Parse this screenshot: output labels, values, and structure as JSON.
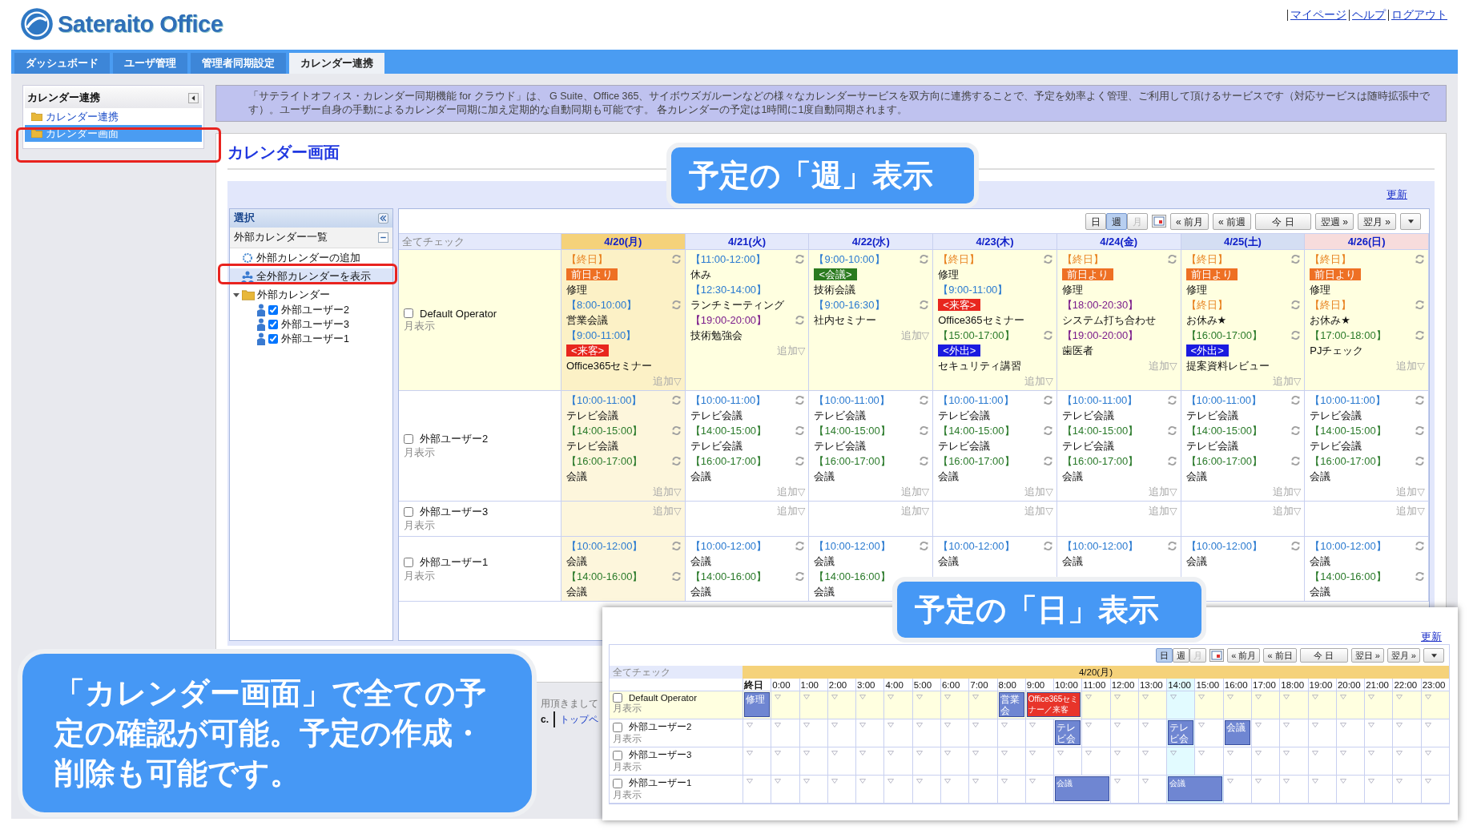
{
  "logo": {
    "text": "Sateraito Office"
  },
  "top_links": [
    "マイページ",
    "ヘルプ",
    "ログアウト"
  ],
  "nav_tabs": [
    {
      "label": "ダッシュボード",
      "selected": false
    },
    {
      "label": "ユーザ管理",
      "selected": false
    },
    {
      "label": "管理者同期設定",
      "selected": false
    },
    {
      "label": "カレンダー連携",
      "selected": true
    }
  ],
  "sidebar": {
    "title": "カレンダー連携",
    "items": [
      {
        "label": "カレンダー連携",
        "selected": false
      },
      {
        "label": "カレンダー画面",
        "selected": true
      }
    ]
  },
  "banner": "「サテライトオフィス・カレンダー同期機能 for クラウド」は、 G Suite、Office 365、サイボウズガルーンなどの様々なカレンダーサービスを双方向に連携することで、予定を効率よく管理、ご利用して頂けるサービスです（対応サービスは随時拡張中です）。ユーザー自身の手動によるカレンダー同期に加え定期的な自動同期も可能です。 各カレンダーの予定は1時間に1度自動同期されます。",
  "page_title": "カレンダー画面",
  "week_view": {
    "refresh": "更新",
    "select_panel": {
      "title": "選択",
      "list_title": "外部カレンダー一覧",
      "tree": [
        {
          "kind": "add",
          "label": "外部カレンダーの追加",
          "selected": false
        },
        {
          "kind": "show_all",
          "label": "全外部カレンダーを表示",
          "selected": true
        },
        {
          "kind": "folder",
          "label": "外部カレンダー",
          "expanded": true,
          "selected": false,
          "children": [
            {
              "label": "外部ユーザー2",
              "checked": true
            },
            {
              "label": "外部ユーザー3",
              "checked": true
            },
            {
              "label": "外部ユーザー1",
              "checked": true
            }
          ]
        }
      ]
    },
    "toolbar": {
      "views": [
        {
          "label": "日",
          "selected": false,
          "disabled": false
        },
        {
          "label": "週",
          "selected": true,
          "disabled": false
        },
        {
          "label": "月",
          "selected": false,
          "disabled": true
        }
      ],
      "buttons": [
        "« 前月",
        "« 前週",
        "今 日",
        "翌週 »",
        "翌月 »"
      ]
    },
    "check_all": "全てチェック",
    "days": [
      {
        "label": "4/20(月)",
        "kind": "today"
      },
      {
        "label": "4/21(火)",
        "kind": "normal"
      },
      {
        "label": "4/22(水)",
        "kind": "normal"
      },
      {
        "label": "4/23(木)",
        "kind": "normal"
      },
      {
        "label": "4/24(金)",
        "kind": "normal"
      },
      {
        "label": "4/25(土)",
        "kind": "saturday"
      },
      {
        "label": "4/26(日)",
        "kind": "sunday"
      }
    ],
    "rows": [
      {
        "name": "Default Operator",
        "sub": "月表示",
        "checked": false,
        "own": true,
        "cells": [
          {
            "add": "追加▽",
            "events": [
              {
                "time": "【終日】",
                "color": "#e8801e",
                "tag": {
                  "label": "前日より",
                  "color": "#ee7024"
                },
                "title": "修理",
                "sync": true
              },
              {
                "time": "【8:00-10:00】",
                "color": "#2a7ad0",
                "title": "営業会議",
                "sync": true
              },
              {
                "time": "【9:00-11:00】",
                "color": "#2a7ad0",
                "tag": {
                  "label": "<来客>",
                  "color": "#e8261e"
                },
                "title": "Office365セミナー",
                "sync": false
              }
            ]
          },
          {
            "add": "追加▽",
            "events": [
              {
                "time": "【11:00-12:00】",
                "color": "#2a7ad0",
                "title": "休み",
                "sync": true
              },
              {
                "time": "【12:30-14:00】",
                "color": "#2a7ad0",
                "title": "ランチミーティング",
                "sync": false
              },
              {
                "time": "【19:00-20:00】",
                "color": "#7a1a8a",
                "title": "技術勉強会",
                "sync": true
              }
            ]
          },
          {
            "add": "追加▽",
            "events": [
              {
                "time": "【9:00-10:00】",
                "color": "#2a7ad0",
                "tag": {
                  "label": "<会議>",
                  "color": "#2a7a1e"
                },
                "title": "技術会議",
                "sync": true
              },
              {
                "time": "【9:00-16:30】",
                "color": "#2a7ad0",
                "title": "社内セミナー",
                "sync": true
              }
            ]
          },
          {
            "add": "追加▽",
            "events": [
              {
                "time": "【終日】",
                "color": "#e8801e",
                "title": "修理",
                "sync": true
              },
              {
                "time": "【9:00-11:00】",
                "color": "#2a7ad0",
                "tag": {
                  "label": "<来客>",
                  "color": "#e8261e"
                },
                "title": "Office365セミナー",
                "sync": false
              },
              {
                "time": "【15:00-17:00】",
                "color": "#2a7a2a",
                "tag": {
                  "label": "<外出>",
                  "color": "#1a1ae0"
                },
                "title": "セキュリティ講習",
                "sync": true
              }
            ]
          },
          {
            "add": "追加▽",
            "events": [
              {
                "time": "【終日】",
                "color": "#e8801e",
                "tag": {
                  "label": "前日より",
                  "color": "#ee7024"
                },
                "title": "修理",
                "sync": true
              },
              {
                "time": "【18:00-20:30】",
                "color": "#7a1a8a",
                "title": "システム打ち合わせ",
                "sync": false
              },
              {
                "time": "【19:00-20:00】",
                "color": "#7a1a8a",
                "title": "歯医者",
                "sync": false
              }
            ]
          },
          {
            "add": "追加▽",
            "events": [
              {
                "time": "【終日】",
                "color": "#e8801e",
                "tag": {
                  "label": "前日より",
                  "color": "#ee7024"
                },
                "title": "修理",
                "sync": true
              },
              {
                "time": "【終日】",
                "color": "#e8801e",
                "title": "お休み★",
                "sync": true
              },
              {
                "time": "【16:00-17:00】",
                "color": "#2a7a2a",
                "tag": {
                  "label": "<外出>",
                  "color": "#1a1ae0"
                },
                "title": "提案資料レビュー",
                "sync": true
              }
            ]
          },
          {
            "add": "追加▽",
            "events": [
              {
                "time": "【終日】",
                "color": "#e8801e",
                "tag": {
                  "label": "前日より",
                  "color": "#ee7024"
                },
                "title": "修理",
                "sync": true
              },
              {
                "time": "【終日】",
                "color": "#e8801e",
                "title": "お休み★",
                "sync": true
              },
              {
                "time": "【17:00-18:00】",
                "color": "#2a7a2a",
                "title": "PJチェック",
                "sync": true
              }
            ]
          }
        ]
      },
      {
        "name": "外部ユーザー2",
        "sub": "月表示",
        "checked": false,
        "own": false,
        "cells": [
          {
            "add": "追加▽",
            "events": [
              {
                "time": "【10:00-11:00】",
                "color": "#2a7ad0",
                "title": "テレビ会議",
                "sync": true
              },
              {
                "time": "【14:00-15:00】",
                "color": "#2a7a2a",
                "title": "テレビ会議",
                "sync": true
              },
              {
                "time": "【16:00-17:00】",
                "color": "#2a7a2a",
                "title": "会議",
                "sync": true
              }
            ]
          },
          {
            "add": "追加▽",
            "events": [
              {
                "time": "【10:00-11:00】",
                "color": "#2a7ad0",
                "title": "テレビ会議",
                "sync": true
              },
              {
                "time": "【14:00-15:00】",
                "color": "#2a7a2a",
                "title": "テレビ会議",
                "sync": true
              },
              {
                "time": "【16:00-17:00】",
                "color": "#2a7a2a",
                "title": "会議",
                "sync": true
              }
            ]
          },
          {
            "add": "追加▽",
            "events": [
              {
                "time": "【10:00-11:00】",
                "color": "#2a7ad0",
                "title": "テレビ会議",
                "sync": true
              },
              {
                "time": "【14:00-15:00】",
                "color": "#2a7a2a",
                "title": "テレビ会議",
                "sync": true
              },
              {
                "time": "【16:00-17:00】",
                "color": "#2a7a2a",
                "title": "会議",
                "sync": true
              }
            ]
          },
          {
            "add": "追加▽",
            "events": [
              {
                "time": "【10:00-11:00】",
                "color": "#2a7ad0",
                "title": "テレビ会議",
                "sync": true
              },
              {
                "time": "【14:00-15:00】",
                "color": "#2a7a2a",
                "title": "テレビ会議",
                "sync": true
              },
              {
                "time": "【16:00-17:00】",
                "color": "#2a7a2a",
                "title": "会議",
                "sync": true
              }
            ]
          },
          {
            "add": "追加▽",
            "events": [
              {
                "time": "【10:00-11:00】",
                "color": "#2a7ad0",
                "title": "テレビ会議",
                "sync": true
              },
              {
                "time": "【14:00-15:00】",
                "color": "#2a7a2a",
                "title": "テレビ会議",
                "sync": true
              },
              {
                "time": "【16:00-17:00】",
                "color": "#2a7a2a",
                "title": "会議",
                "sync": true
              }
            ]
          },
          {
            "add": "追加▽",
            "events": [
              {
                "time": "【10:00-11:00】",
                "color": "#2a7ad0",
                "title": "テレビ会議",
                "sync": true
              },
              {
                "time": "【14:00-15:00】",
                "color": "#2a7a2a",
                "title": "テレビ会議",
                "sync": true
              },
              {
                "time": "【16:00-17:00】",
                "color": "#2a7a2a",
                "title": "会議",
                "sync": true
              }
            ]
          },
          {
            "add": "追加▽",
            "events": [
              {
                "time": "【10:00-11:00】",
                "color": "#2a7ad0",
                "title": "テレビ会議",
                "sync": true
              },
              {
                "time": "【14:00-15:00】",
                "color": "#2a7a2a",
                "title": "テレビ会議",
                "sync": true
              },
              {
                "time": "【16:00-17:00】",
                "color": "#2a7a2a",
                "title": "会議",
                "sync": true
              }
            ]
          }
        ]
      },
      {
        "name": "外部ユーザー3",
        "sub": "月表示",
        "checked": false,
        "own": false,
        "cells": [
          {
            "add": "追加▽"
          },
          {
            "add": "追加▽"
          },
          {
            "add": "追加▽"
          },
          {
            "add": "追加▽"
          },
          {
            "add": "追加▽"
          },
          {
            "add": "追加▽"
          },
          {
            "add": "追加▽"
          }
        ]
      },
      {
        "name": "外部ユーザー1",
        "sub": "月表示",
        "checked": false,
        "own": false,
        "cells": [
          {
            "events": [
              {
                "time": "【10:00-12:00】",
                "color": "#2a7ad0",
                "title": "会議",
                "sync": true
              },
              {
                "time": "【14:00-16:00】",
                "color": "#2a7a2a",
                "title": "会議",
                "sync": true
              }
            ]
          },
          {
            "events": [
              {
                "time": "【10:00-12:00】",
                "color": "#2a7ad0",
                "title": "会議",
                "sync": true
              },
              {
                "time": "【14:00-16:00】",
                "color": "#2a7a2a",
                "title": "会議",
                "sync": true
              }
            ]
          },
          {
            "events": [
              {
                "time": "【10:00-12:00】",
                "color": "#2a7ad0",
                "title": "会議",
                "sync": true
              },
              {
                "time": "【14:00-16:00】",
                "color": "#2a7a2a",
                "title": "会議",
                "sync": false
              }
            ]
          },
          {
            "events": [
              {
                "time": "【10:00-12:00】",
                "color": "#2a7ad0",
                "title": "会議",
                "sync": true
              }
            ]
          },
          {
            "events": [
              {
                "time": "【10:00-12:00】",
                "color": "#2a7ad0",
                "title": "会議",
                "sync": true
              }
            ]
          },
          {
            "events": [
              {
                "time": "【10:00-12:00】",
                "color": "#2a7ad0",
                "title": "会議",
                "sync": true
              }
            ]
          },
          {
            "events": [
              {
                "time": "【10:00-12:00】",
                "color": "#2a7ad0",
                "title": "会議",
                "sync": true
              },
              {
                "time": "【14:00-16:00】",
                "color": "#2a7a2a",
                "title": "会議",
                "sync": true
              }
            ]
          }
        ]
      }
    ]
  },
  "footer": {
    "line": "用頂きまして",
    "company": "c.",
    "link": "トップペ"
  },
  "day_view": {
    "refresh": "更新",
    "toolbar": {
      "views": [
        {
          "label": "日",
          "selected": true,
          "disabled": false
        },
        {
          "label": "週",
          "selected": false,
          "disabled": false
        },
        {
          "label": "月",
          "selected": false,
          "disabled": true
        }
      ],
      "buttons": [
        "« 前月",
        "« 前日",
        "今 日",
        "翌日 »",
        "翌月 »"
      ]
    },
    "check_all": "全てチェック",
    "date": "4/20(月)",
    "hours": [
      {
        "label": "終日",
        "current": false
      },
      {
        "label": "0:00",
        "current": false
      },
      {
        "label": "1:00",
        "current": false
      },
      {
        "label": "2:00",
        "current": false
      },
      {
        "label": "3:00",
        "current": false
      },
      {
        "label": "4:00",
        "current": false
      },
      {
        "label": "5:00",
        "current": false
      },
      {
        "label": "6:00",
        "current": false
      },
      {
        "label": "7:00",
        "current": false
      },
      {
        "label": "8:00",
        "current": false
      },
      {
        "label": "9:00",
        "current": false
      },
      {
        "label": "10:00",
        "current": false
      },
      {
        "label": "11:00",
        "current": false
      },
      {
        "label": "12:00",
        "current": false
      },
      {
        "label": "13:00",
        "current": false
      },
      {
        "label": "14:00",
        "current": true
      },
      {
        "label": "15:00",
        "current": false
      },
      {
        "label": "16:00",
        "current": false
      },
      {
        "label": "17:00",
        "current": false
      },
      {
        "label": "18:00",
        "current": false
      },
      {
        "label": "19:00",
        "current": false
      },
      {
        "label": "20:00",
        "current": false
      },
      {
        "label": "21:00",
        "current": false
      },
      {
        "label": "22:00",
        "current": false
      },
      {
        "label": "23:00",
        "current": false
      }
    ],
    "rows": [
      {
        "name": "Default Operator",
        "sub": "月表示",
        "checked": false,
        "own": true,
        "slots": [
          {
            "kind": "event",
            "label": "修理",
            "wide": false,
            "color": "#6f86d2"
          },
          {
            "kind": "free"
          },
          {
            "kind": "free"
          },
          {
            "kind": "free"
          },
          {
            "kind": "free"
          },
          {
            "kind": "free"
          },
          {
            "kind": "free"
          },
          {
            "kind": "free"
          },
          {
            "kind": "free"
          },
          {
            "kind": "event",
            "label": "営業会",
            "wide": false,
            "color": "#6f86d2"
          },
          {
            "kind": "event",
            "label": "Office365セミナー／来客",
            "wide": true,
            "color": "#e8342a"
          },
          {
            "kind": "free"
          },
          {
            "kind": "free"
          },
          {
            "kind": "free"
          },
          {
            "kind": "free"
          },
          {
            "kind": "free"
          },
          {
            "kind": "free"
          },
          {
            "kind": "free"
          },
          {
            "kind": "free"
          },
          {
            "kind": "free"
          },
          {
            "kind": "free"
          },
          {
            "kind": "free"
          },
          {
            "kind": "free"
          },
          {
            "kind": "free"
          }
        ]
      },
      {
        "name": "外部ユーザー2",
        "sub": "月表示",
        "checked": false,
        "own": false,
        "slots": [
          {
            "kind": "free"
          },
          {
            "kind": "free"
          },
          {
            "kind": "free"
          },
          {
            "kind": "free"
          },
          {
            "kind": "free"
          },
          {
            "kind": "free"
          },
          {
            "kind": "free"
          },
          {
            "kind": "free"
          },
          {
            "kind": "free"
          },
          {
            "kind": "free"
          },
          {
            "kind": "free"
          },
          {
            "kind": "event",
            "label": "テレビ会",
            "wide": false,
            "color": "#6f86d2"
          },
          {
            "kind": "free"
          },
          {
            "kind": "free"
          },
          {
            "kind": "free"
          },
          {
            "kind": "event",
            "label": "テレビ会",
            "wide": false,
            "color": "#6f86d2"
          },
          {
            "kind": "free"
          },
          {
            "kind": "event",
            "label": "会議",
            "wide": false,
            "color": "#6f86d2"
          },
          {
            "kind": "free"
          },
          {
            "kind": "free"
          },
          {
            "kind": "free"
          },
          {
            "kind": "free"
          },
          {
            "kind": "free"
          },
          {
            "kind": "free"
          },
          {
            "kind": "free"
          }
        ]
      },
      {
        "name": "外部ユーザー3",
        "sub": "月表示",
        "checked": false,
        "own": false,
        "slots": [
          {
            "kind": "free"
          },
          {
            "kind": "free"
          },
          {
            "kind": "free"
          },
          {
            "kind": "free"
          },
          {
            "kind": "free"
          },
          {
            "kind": "free"
          },
          {
            "kind": "free"
          },
          {
            "kind": "free"
          },
          {
            "kind": "free"
          },
          {
            "kind": "free"
          },
          {
            "kind": "free"
          },
          {
            "kind": "free"
          },
          {
            "kind": "free"
          },
          {
            "kind": "free"
          },
          {
            "kind": "free"
          },
          {
            "kind": "free"
          },
          {
            "kind": "free"
          },
          {
            "kind": "free"
          },
          {
            "kind": "free"
          },
          {
            "kind": "free"
          },
          {
            "kind": "free"
          },
          {
            "kind": "free"
          },
          {
            "kind": "free"
          },
          {
            "kind": "free"
          },
          {
            "kind": "free"
          }
        ]
      },
      {
        "name": "外部ユーザー1",
        "sub": "月表示",
        "checked": false,
        "own": false,
        "slots": [
          {
            "kind": "free"
          },
          {
            "kind": "free"
          },
          {
            "kind": "free"
          },
          {
            "kind": "free"
          },
          {
            "kind": "free"
          },
          {
            "kind": "free"
          },
          {
            "kind": "free"
          },
          {
            "kind": "free"
          },
          {
            "kind": "free"
          },
          {
            "kind": "free"
          },
          {
            "kind": "free"
          },
          {
            "kind": "event",
            "label": "会議",
            "wide": true,
            "color": "#6f86d2"
          },
          {
            "kind": "free"
          },
          {
            "kind": "free"
          },
          {
            "kind": "event",
            "label": "会議",
            "wide": true,
            "color": "#6f86d2"
          },
          {
            "kind": "free"
          },
          {
            "kind": "free"
          },
          {
            "kind": "free"
          },
          {
            "kind": "free"
          },
          {
            "kind": "free"
          },
          {
            "kind": "free"
          },
          {
            "kind": "free"
          },
          {
            "kind": "free"
          }
        ]
      }
    ]
  },
  "callouts": [
    {
      "kind": "week",
      "text": "予定の「週」表示"
    },
    {
      "kind": "day",
      "text": "予定の「日」表示"
    },
    {
      "kind": "note",
      "text": "「カレンダー画面」で全ての予定の確認が可能。予定の作成・削除も可能です。"
    }
  ]
}
